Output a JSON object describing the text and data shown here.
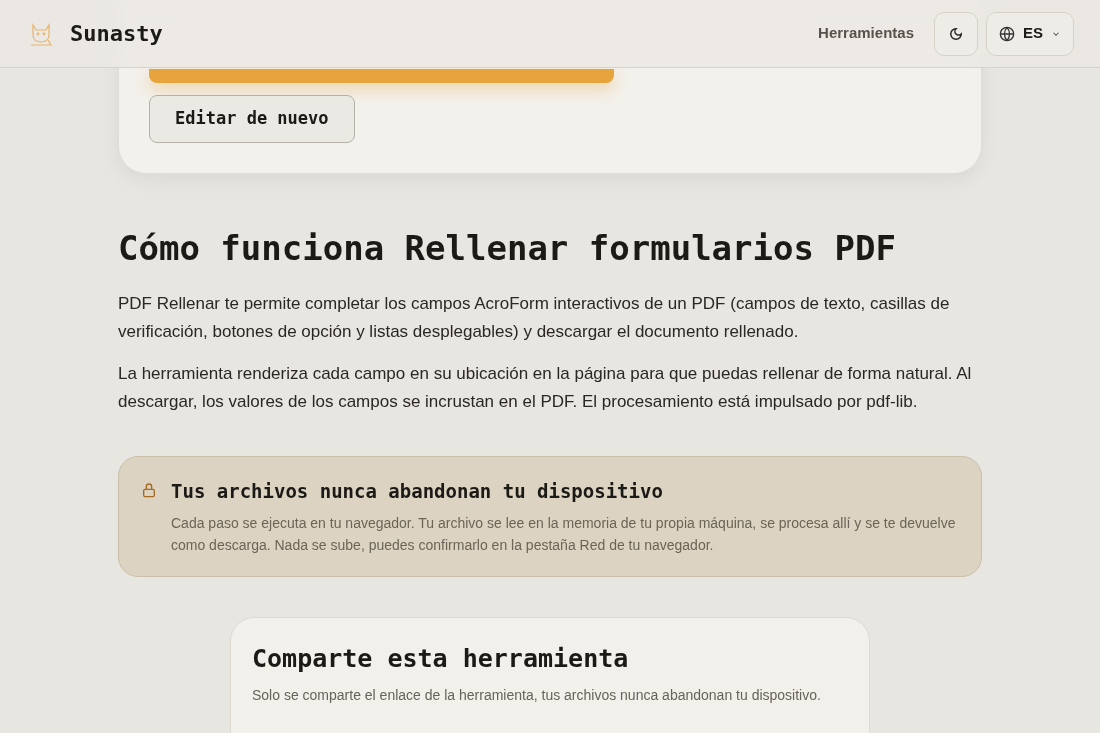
{
  "header": {
    "brand": "Sunasty",
    "nav_link": "Herramientas",
    "language": "ES"
  },
  "result_card": {
    "edit_button": "Editar de nuevo"
  },
  "how_it_works": {
    "title": "Cómo funciona Rellenar formularios PDF",
    "paragraphs": [
      "PDF Rellenar te permite completar los campos AcroForm interactivos de un PDF (campos de texto, casillas de verificación, botones de opción y listas desplegables) y descargar el documento rellenado.",
      "La herramienta renderiza cada campo en su ubicación en la página para que puedas rellenar de forma natural. Al descargar, los valores de los campos se incrustan en el PDF. El procesamiento está impulsado por pdf-lib."
    ]
  },
  "privacy_notice": {
    "title": "Tus archivos nunca abandonan tu dispositivo",
    "text": "Cada paso se ejecuta en tu navegador. Tu archivo se lee en la memoria de tu propia máquina, se procesa allí y se te devuelve como descarga. Nada se sube, puedes confirmarlo en la pestaña Red de tu navegador."
  },
  "share_card": {
    "title": "Comparte esta herramienta",
    "text": "Solo se comparte el enlace de la herramienta, tus archivos nunca abandonan tu dispositivo."
  }
}
